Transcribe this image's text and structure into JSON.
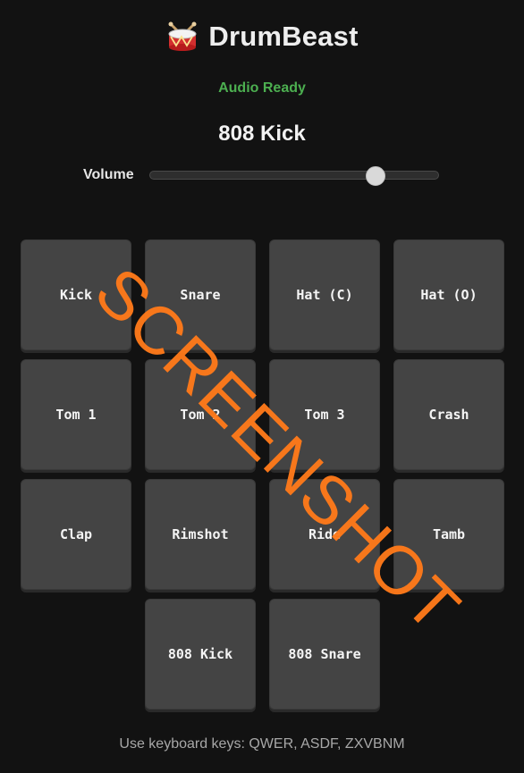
{
  "header": {
    "title": "DrumBeast",
    "icon": "drum-icon"
  },
  "status": {
    "text": "Audio Ready",
    "color": "#4caf50"
  },
  "current_sound": "808 Kick",
  "volume": {
    "label": "Volume",
    "value": 0.78
  },
  "pads": [
    {
      "label": "Kick"
    },
    {
      "label": "Snare"
    },
    {
      "label": "Hat (C)"
    },
    {
      "label": "Hat (O)"
    },
    {
      "label": "Tom 1"
    },
    {
      "label": "Tom 2"
    },
    {
      "label": "Tom 3"
    },
    {
      "label": "Crash"
    },
    {
      "label": "Clap"
    },
    {
      "label": "Rimshot"
    },
    {
      "label": "Ride"
    },
    {
      "label": "Tamb"
    },
    {
      "label": "808 Kick"
    },
    {
      "label": "808 Snare"
    }
  ],
  "footer": {
    "text": "Use keyboard keys: QWER, ASDF, ZXVBNM"
  },
  "watermark": {
    "text": "SCREENSHOT",
    "color": "#ff7a1a"
  }
}
